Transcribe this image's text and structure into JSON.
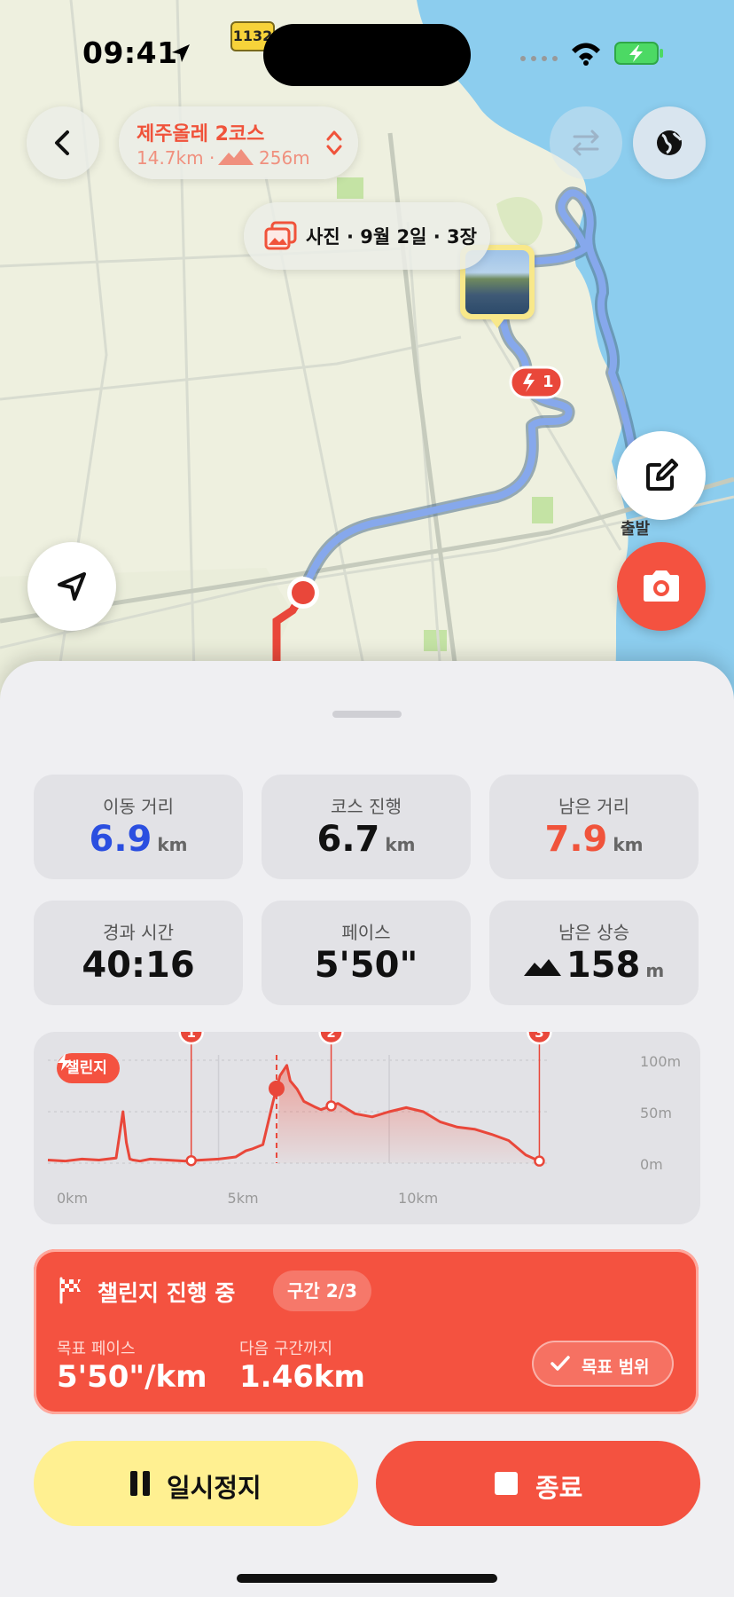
{
  "status_bar": {
    "time": "09:41"
  },
  "map": {
    "road_badge": "1132",
    "start_label": "출발",
    "segment_marker": "1",
    "photo_bubble": {
      "label": "사진 · 9월 2일 · 3장"
    }
  },
  "course": {
    "title": "제주올레 2코스",
    "distance": "14.7km ·",
    "elevation": "256m"
  },
  "stats": [
    {
      "label": "이동 거리",
      "value": "6.9",
      "unit": "km",
      "color": "#2b4fe0"
    },
    {
      "label": "코스 진행",
      "value": "6.7",
      "unit": "km",
      "color": "#111111"
    },
    {
      "label": "남은 거리",
      "value": "7.9",
      "unit": "km",
      "color": "#f0533b"
    },
    {
      "label": "경과 시간",
      "value": "40:16",
      "unit": "",
      "color": "#111111"
    },
    {
      "label": "페이스",
      "value": "5'50\"",
      "unit": "",
      "color": "#111111"
    },
    {
      "label": "남은 상승",
      "value": "158",
      "unit": "m",
      "color": "#111111"
    }
  ],
  "chart_data": {
    "type": "area",
    "badge": "챌린지",
    "x_unit": "km",
    "y_unit": "m",
    "x_ticks": [
      "0km",
      "5km",
      "10km"
    ],
    "y_ticks": [
      "100m",
      "50m",
      "0m"
    ],
    "xlim": [
      0,
      14.7
    ],
    "ylim": [
      0,
      100
    ],
    "x": [
      0,
      0.5,
      1.0,
      1.5,
      2.0,
      2.2,
      2.3,
      2.4,
      2.5,
      2.7,
      3.0,
      3.5,
      4.0,
      4.5,
      5.0,
      5.5,
      5.8,
      6.0,
      6.3,
      6.6,
      6.8,
      7.0,
      7.1,
      7.3,
      7.5,
      7.8,
      8.0,
      8.5,
      9.0,
      9.5,
      10.0,
      10.5,
      11.0,
      11.5,
      12.0,
      12.5,
      13.0,
      13.5,
      14.0,
      14.4
    ],
    "y": [
      3,
      2,
      4,
      3,
      5,
      50,
      20,
      4,
      3,
      2,
      4,
      3,
      2,
      3,
      4,
      6,
      12,
      14,
      18,
      60,
      85,
      95,
      80,
      72,
      60,
      55,
      52,
      58,
      48,
      45,
      50,
      54,
      50,
      40,
      35,
      33,
      28,
      22,
      8,
      2
    ],
    "current_km": 6.7,
    "markers": [
      {
        "label": "1",
        "km": 4.2
      },
      {
        "label": "2",
        "km": 8.3
      },
      {
        "label": "3",
        "km": 14.4
      }
    ]
  },
  "challenge": {
    "title": "챌린지 진행 중",
    "segment": "구간 2/3",
    "target_pace_label": "목표 페이스",
    "target_pace": "5'50\"/km",
    "next_label": "다음 구간까지",
    "next_value": "1.46km",
    "status": "목표 범위"
  },
  "actions": {
    "pause": "일시정지",
    "end": "종료"
  },
  "colors": {
    "accent": "#f45240",
    "route": "#7a9fe6",
    "pause_bg": "#fff091"
  }
}
